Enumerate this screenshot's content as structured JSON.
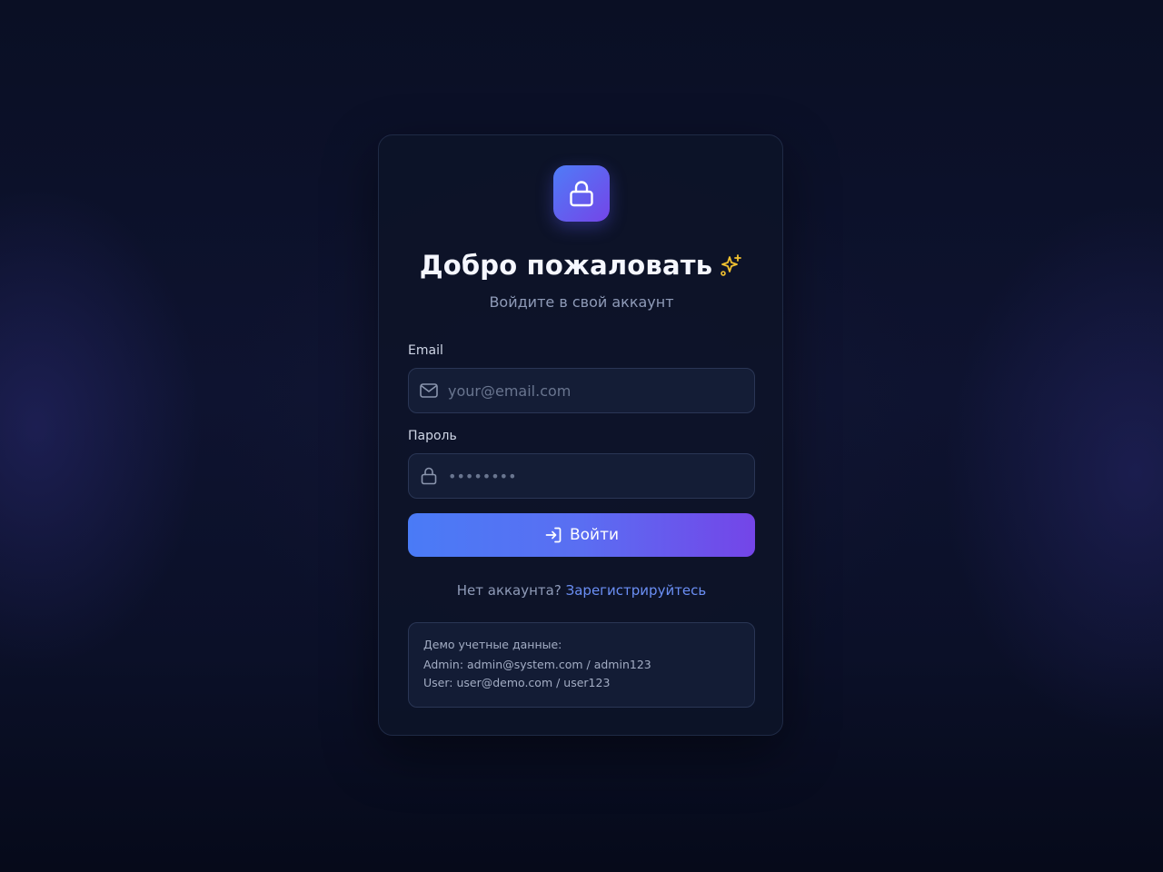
{
  "header": {
    "title": "Добро пожаловать",
    "subtitle": "Войдите в свой аккаунт",
    "logo_icon": "lock-icon",
    "title_icon": "sparkles-icon"
  },
  "form": {
    "email": {
      "label": "Email",
      "placeholder": "your@email.com",
      "value": "",
      "icon": "mail-icon"
    },
    "password": {
      "label": "Пароль",
      "placeholder": "••••••••",
      "value": "",
      "icon": "lock-icon"
    },
    "submit": {
      "label": "Войти",
      "icon": "log-in-icon"
    }
  },
  "signup": {
    "prompt": "Нет аккаунта?",
    "link": "Зарегистрируйтесь"
  },
  "demo": {
    "heading": "Демо учетные данные:",
    "admin": "Admin: admin@system.com / admin123",
    "user": "User: user@demo.com / user123"
  },
  "colors": {
    "accent_start": "#4a7bf6",
    "accent_end": "#7445e8",
    "link": "#6b8ff5",
    "sparkle": "#f2c230"
  }
}
